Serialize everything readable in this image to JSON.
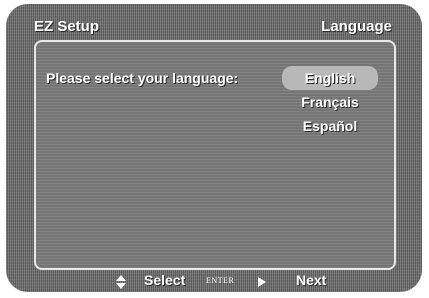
{
  "header": {
    "title": "EZ Setup",
    "section": "Language"
  },
  "main": {
    "prompt": "Please select your language:",
    "languages": [
      {
        "label": "English",
        "selected": true
      },
      {
        "label": "Français",
        "selected": false
      },
      {
        "label": "Español",
        "selected": false
      }
    ]
  },
  "footer": {
    "select_label": "Select",
    "enter_label": "ENTER",
    "next_label": "Next"
  },
  "colors": {
    "background": "#6d6d6d",
    "panel": "#7a7a7a",
    "highlight": "#b8b8b8",
    "text": "#ffffff"
  }
}
